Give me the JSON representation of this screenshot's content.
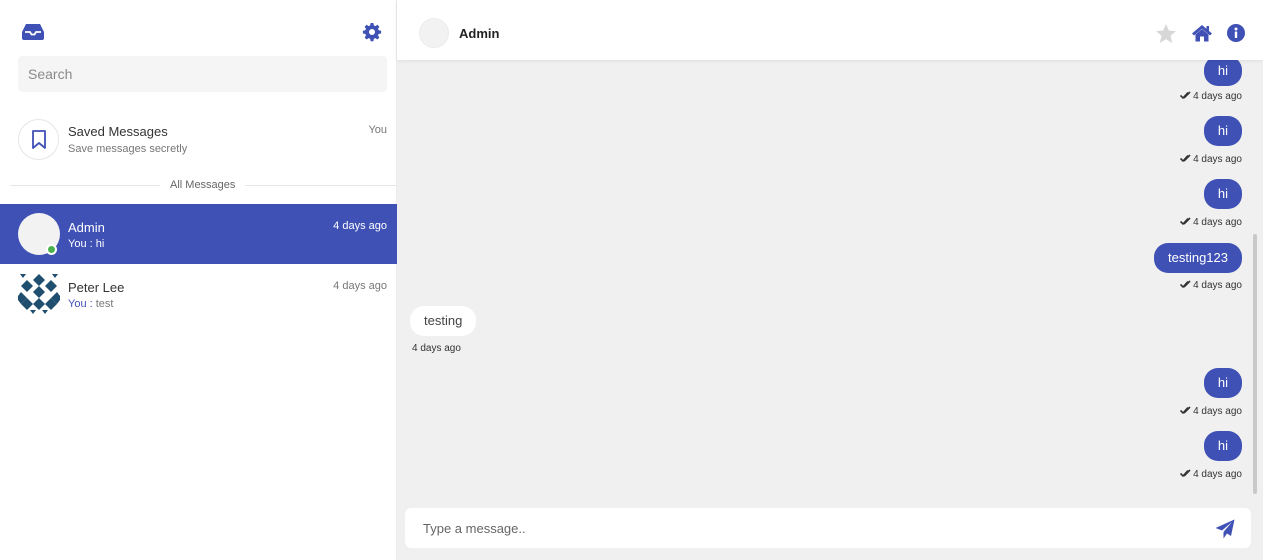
{
  "colors": {
    "accent": "#3f51b5",
    "online": "#4caf50"
  },
  "sidebar": {
    "search": {
      "placeholder": "Search",
      "value": ""
    },
    "saved": {
      "name": "Saved Messages",
      "subtitle": "Save messages secretly",
      "tag": "You"
    },
    "divider_label": "All Messages",
    "chats": [
      {
        "name": "Admin",
        "you_prefix": "You :",
        "last_message": "hi",
        "time": "4 days ago",
        "active": true,
        "online": true
      },
      {
        "name": "Peter Lee",
        "you_prefix": "You :",
        "last_message": "test",
        "time": "4 days ago",
        "active": false,
        "online": false
      }
    ]
  },
  "header": {
    "name": "Admin"
  },
  "messages": [
    {
      "text": "hi",
      "dir": "out",
      "time": "4 days ago"
    },
    {
      "text": "hi",
      "dir": "out",
      "time": "4 days ago"
    },
    {
      "text": "hi",
      "dir": "out",
      "time": "4 days ago"
    },
    {
      "text": "testing123",
      "dir": "out",
      "time": "4 days ago"
    },
    {
      "text": "testing",
      "dir": "in",
      "time": "4 days ago"
    },
    {
      "text": "hi",
      "dir": "out",
      "time": "4 days ago"
    },
    {
      "text": "hi",
      "dir": "out",
      "time": "4 days ago"
    }
  ],
  "composer": {
    "placeholder": "Type a message.."
  }
}
